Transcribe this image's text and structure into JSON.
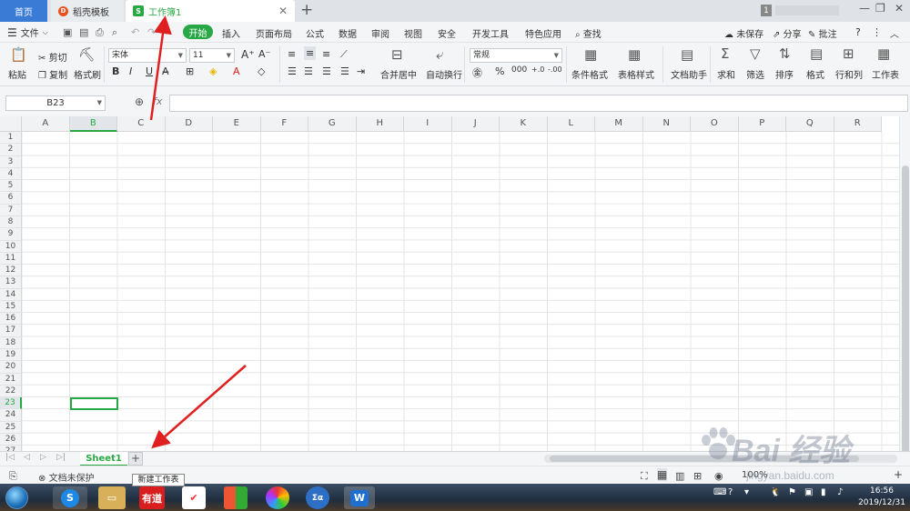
{
  "titlebar": {
    "home_tab": "首页",
    "tabs": [
      {
        "label": "稻壳模板"
      },
      {
        "label": "工作簿1"
      }
    ],
    "badge": "1"
  },
  "menu": {
    "file": "文件",
    "start": "开始",
    "items": [
      "插入",
      "页面布局",
      "公式",
      "数据",
      "审阅",
      "视图",
      "安全",
      "开发工具",
      "特色应用"
    ],
    "search": "查找",
    "unsaved": "未保存",
    "share": "分享",
    "comment": "批注"
  },
  "ribbon": {
    "paste": "粘贴",
    "cut": "剪切",
    "copy": "复制",
    "format_painter": "格式刷",
    "font_name": "宋体",
    "font_size": "11",
    "merge_center": "合并居中",
    "auto_wrap": "自动换行",
    "number_format": "常规",
    "conditional_format": "条件格式",
    "table_style": "表格样式",
    "doc_assistant": "文档助手",
    "sum": "求和",
    "filter": "筛选",
    "sort": "排序",
    "format": "格式",
    "rows_cols": "行和列",
    "worksheet": "工作表"
  },
  "formula_bar": {
    "name_box": "B23",
    "fx": "fx"
  },
  "grid": {
    "columns": [
      "A",
      "B",
      "C",
      "D",
      "E",
      "F",
      "G",
      "H",
      "I",
      "J",
      "K",
      "L",
      "M",
      "N",
      "O",
      "P",
      "Q",
      "R"
    ],
    "rows": [
      "1",
      "2",
      "3",
      "4",
      "5",
      "6",
      "7",
      "8",
      "9",
      "10",
      "11",
      "12",
      "13",
      "14",
      "15",
      "16",
      "17",
      "18",
      "19",
      "20",
      "21",
      "22",
      "23",
      "24",
      "25",
      "26",
      "27"
    ],
    "selected_column": "B",
    "selected_row": "23"
  },
  "sheets": {
    "tabs": [
      "Sheet1"
    ],
    "add_label": "+",
    "tooltip": "新建工作表"
  },
  "status": {
    "protection": "文档未保护",
    "zoom": "100%"
  },
  "taskbar": {
    "youdao": "有道",
    "time": "16:56",
    "date": "2019/12/31"
  },
  "watermark": {
    "brand": "Bai 经验",
    "url": "jingyan.baidu.com"
  },
  "colors": {
    "accent": "#27a844",
    "home_tab": "#3a7bd5",
    "arrow": "#e02020"
  }
}
